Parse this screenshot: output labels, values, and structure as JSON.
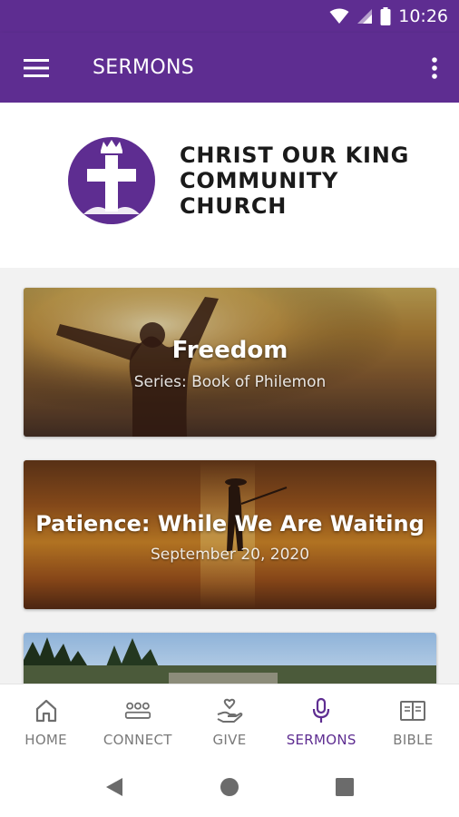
{
  "status_bar": {
    "time": "10:26"
  },
  "app_bar": {
    "title": "SERMONS",
    "color": "#5e2d91"
  },
  "church": {
    "name_lines": [
      "CHRIST OUR KING",
      "COMMUNITY",
      "CHURCH"
    ]
  },
  "sermons": [
    {
      "title": "Freedom",
      "subtitle": "Series: Book of Philemon"
    },
    {
      "title": "Patience: While We Are Waiting",
      "subtitle": "September 20, 2020"
    },
    {
      "title": "",
      "subtitle": ""
    }
  ],
  "bottom_nav": {
    "items": [
      {
        "label": "HOME",
        "icon": "home-icon",
        "active": false
      },
      {
        "label": "CONNECT",
        "icon": "connect-group-icon",
        "active": false
      },
      {
        "label": "GIVE",
        "icon": "give-hand-heart-icon",
        "active": false
      },
      {
        "label": "SERMONS",
        "icon": "microphone-icon",
        "active": true
      },
      {
        "label": "BIBLE",
        "icon": "book-icon",
        "active": false
      }
    ],
    "active_color": "#5e2d91",
    "inactive_color": "#7a7a7a"
  },
  "system_nav": {
    "buttons": [
      "back-icon",
      "home-circle-icon",
      "recents-square-icon"
    ]
  }
}
